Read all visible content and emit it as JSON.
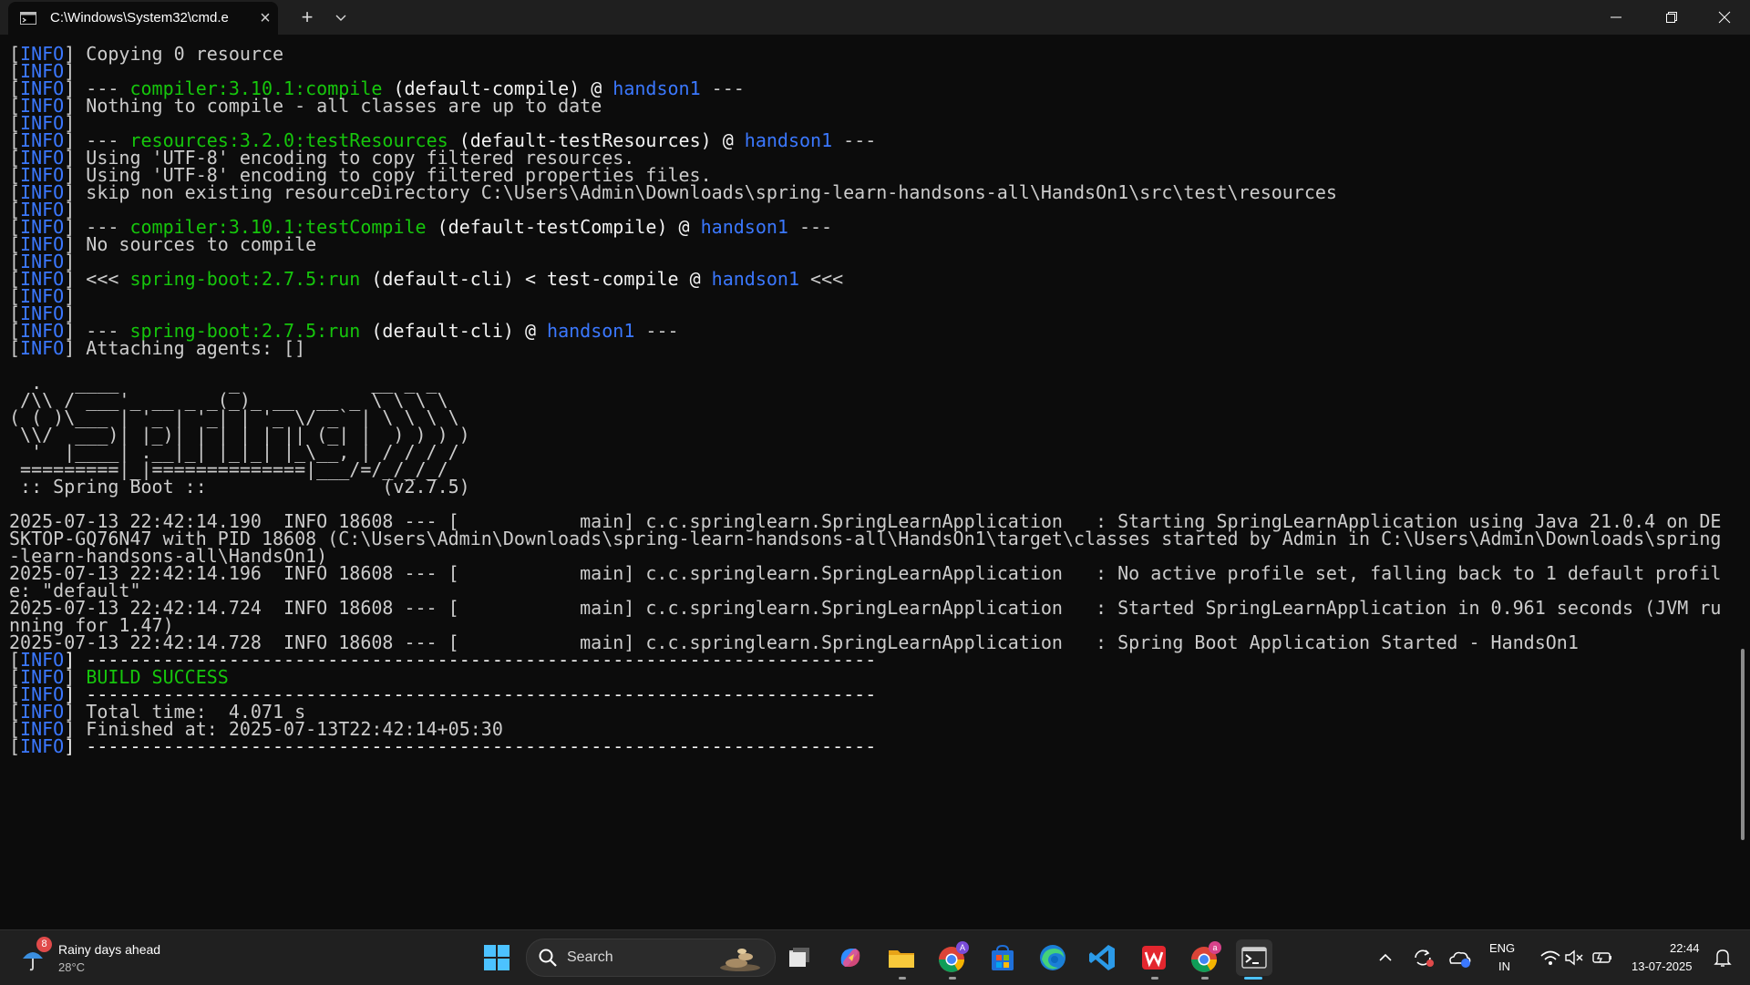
{
  "window": {
    "tab_title": "C:\\Windows\\System32\\cmd.e",
    "tab_close": "×",
    "new_tab": "+",
    "dropdown": "⌄"
  },
  "terminal": {
    "lines": [
      [
        {
          "t": "[",
          "c": ""
        },
        {
          "t": "INFO",
          "c": "lbl"
        },
        {
          "t": "] Copying 0 resource",
          "c": ""
        }
      ],
      [
        {
          "t": "[",
          "c": ""
        },
        {
          "t": "INFO",
          "c": "lbl"
        },
        {
          "t": "]",
          "c": ""
        }
      ],
      [
        {
          "t": "[",
          "c": ""
        },
        {
          "t": "INFO",
          "c": "lbl"
        },
        {
          "t": "] --- ",
          "c": ""
        },
        {
          "t": "compiler:3.10.1:compile",
          "c": "grn"
        },
        {
          "t": " (default-compile) @ ",
          "c": "bold"
        },
        {
          "t": "handson1",
          "c": "blu"
        },
        {
          "t": " ---",
          "c": ""
        }
      ],
      [
        {
          "t": "[",
          "c": ""
        },
        {
          "t": "INFO",
          "c": "lbl"
        },
        {
          "t": "] Nothing to compile - all classes are up to date",
          "c": ""
        }
      ],
      [
        {
          "t": "[",
          "c": ""
        },
        {
          "t": "INFO",
          "c": "lbl"
        },
        {
          "t": "]",
          "c": ""
        }
      ],
      [
        {
          "t": "[",
          "c": ""
        },
        {
          "t": "INFO",
          "c": "lbl"
        },
        {
          "t": "] --- ",
          "c": ""
        },
        {
          "t": "resources:3.2.0:testResources",
          "c": "grn"
        },
        {
          "t": " (default-testResources) @ ",
          "c": "bold"
        },
        {
          "t": "handson1",
          "c": "blu"
        },
        {
          "t": " ---",
          "c": ""
        }
      ],
      [
        {
          "t": "[",
          "c": ""
        },
        {
          "t": "INFO",
          "c": "lbl"
        },
        {
          "t": "] Using 'UTF-8' encoding to copy filtered resources.",
          "c": ""
        }
      ],
      [
        {
          "t": "[",
          "c": ""
        },
        {
          "t": "INFO",
          "c": "lbl"
        },
        {
          "t": "] Using 'UTF-8' encoding to copy filtered properties files.",
          "c": ""
        }
      ],
      [
        {
          "t": "[",
          "c": ""
        },
        {
          "t": "INFO",
          "c": "lbl"
        },
        {
          "t": "] skip non existing resourceDirectory C:\\Users\\Admin\\Downloads\\spring-learn-handsons-all\\HandsOn1\\src\\test\\resources",
          "c": ""
        }
      ],
      [
        {
          "t": "[",
          "c": ""
        },
        {
          "t": "INFO",
          "c": "lbl"
        },
        {
          "t": "]",
          "c": ""
        }
      ],
      [
        {
          "t": "[",
          "c": ""
        },
        {
          "t": "INFO",
          "c": "lbl"
        },
        {
          "t": "] --- ",
          "c": ""
        },
        {
          "t": "compiler:3.10.1:testCompile",
          "c": "grn"
        },
        {
          "t": " (default-testCompile) @ ",
          "c": "bold"
        },
        {
          "t": "handson1",
          "c": "blu"
        },
        {
          "t": " ---",
          "c": ""
        }
      ],
      [
        {
          "t": "[",
          "c": ""
        },
        {
          "t": "INFO",
          "c": "lbl"
        },
        {
          "t": "] No sources to compile",
          "c": ""
        }
      ],
      [
        {
          "t": "[",
          "c": ""
        },
        {
          "t": "INFO",
          "c": "lbl"
        },
        {
          "t": "]",
          "c": ""
        }
      ],
      [
        {
          "t": "[",
          "c": ""
        },
        {
          "t": "INFO",
          "c": "lbl"
        },
        {
          "t": "] <<< ",
          "c": ""
        },
        {
          "t": "spring-boot:2.7.5:run",
          "c": "grn"
        },
        {
          "t": " (default-cli) < test-compile @ ",
          "c": "bold"
        },
        {
          "t": "handson1",
          "c": "blu"
        },
        {
          "t": " <<<",
          "c": ""
        }
      ],
      [
        {
          "t": "[",
          "c": ""
        },
        {
          "t": "INFO",
          "c": "lbl"
        },
        {
          "t": "]",
          "c": ""
        }
      ],
      [
        {
          "t": "[",
          "c": ""
        },
        {
          "t": "INFO",
          "c": "lbl"
        },
        {
          "t": "]",
          "c": ""
        }
      ],
      [
        {
          "t": "[",
          "c": ""
        },
        {
          "t": "INFO",
          "c": "lbl"
        },
        {
          "t": "] --- ",
          "c": ""
        },
        {
          "t": "spring-boot:2.7.5:run",
          "c": "grn"
        },
        {
          "t": " (default-cli) @ ",
          "c": "bold"
        },
        {
          "t": "handson1",
          "c": "blu"
        },
        {
          "t": " ---",
          "c": ""
        }
      ],
      [
        {
          "t": "[",
          "c": ""
        },
        {
          "t": "INFO",
          "c": "lbl"
        },
        {
          "t": "] Attaching agents: []",
          "c": ""
        }
      ],
      [
        {
          "t": "",
          "c": ""
        }
      ],
      [
        {
          "t": "  .   ____          _            __ _ _",
          "c": ""
        }
      ],
      [
        {
          "t": " /\\\\ / ___'_ __ _ _(_)_ __  __ _ \\ \\ \\ \\",
          "c": ""
        }
      ],
      [
        {
          "t": "( ( )\\___ | '_ | '_| | '_ \\/ _` | \\ \\ \\ \\",
          "c": ""
        }
      ],
      [
        {
          "t": " \\\\/  ___)| |_)| | | | | || (_| |  ) ) ) )",
          "c": ""
        }
      ],
      [
        {
          "t": "  '  |____| .__|_| |_|_| |_\\__, | / / / /",
          "c": ""
        }
      ],
      [
        {
          "t": " =========|_|==============|___/=/_/_/_/",
          "c": ""
        }
      ],
      [
        {
          "t": " :: Spring Boot ::                (v2.7.5)",
          "c": ""
        }
      ],
      [
        {
          "t": "",
          "c": ""
        }
      ],
      [
        {
          "t": "2025-07-13 22:42:14.190  INFO 18608 --- [           main] c.c.springlearn.SpringLearnApplication   : Starting SpringLearnApplication using Java 21.0.4 on DE",
          "c": ""
        }
      ],
      [
        {
          "t": "SKTOP-GQ76N47 with PID 18608 (C:\\Users\\Admin\\Downloads\\spring-learn-handsons-all\\HandsOn1\\target\\classes started by Admin in C:\\Users\\Admin\\Downloads\\spring",
          "c": ""
        }
      ],
      [
        {
          "t": "-learn-handsons-all\\HandsOn1)",
          "c": ""
        }
      ],
      [
        {
          "t": "2025-07-13 22:42:14.196  INFO 18608 --- [           main] c.c.springlearn.SpringLearnApplication   : No active profile set, falling back to 1 default profil",
          "c": ""
        }
      ],
      [
        {
          "t": "e: \"default\"",
          "c": ""
        }
      ],
      [
        {
          "t": "2025-07-13 22:42:14.724  INFO 18608 --- [           main] c.c.springlearn.SpringLearnApplication   : Started SpringLearnApplication in 0.961 seconds (JVM ru",
          "c": ""
        }
      ],
      [
        {
          "t": "nning for 1.47)",
          "c": ""
        }
      ],
      [
        {
          "t": "2025-07-13 22:42:14.728  INFO 18608 --- [           main] c.c.springlearn.SpringLearnApplication   : Spring Boot Application Started - HandsOn1",
          "c": ""
        }
      ],
      [
        {
          "t": "[",
          "c": ""
        },
        {
          "t": "INFO",
          "c": "lbl"
        },
        {
          "t": "] ------------------------------------------------------------------------",
          "c": "bold"
        }
      ],
      [
        {
          "t": "[",
          "c": ""
        },
        {
          "t": "INFO",
          "c": "lbl"
        },
        {
          "t": "] ",
          "c": ""
        },
        {
          "t": "BUILD SUCCESS",
          "c": "grn"
        }
      ],
      [
        {
          "t": "[",
          "c": ""
        },
        {
          "t": "INFO",
          "c": "lbl"
        },
        {
          "t": "] ------------------------------------------------------------------------",
          "c": "bold"
        }
      ],
      [
        {
          "t": "[",
          "c": ""
        },
        {
          "t": "INFO",
          "c": "lbl"
        },
        {
          "t": "] Total time:  4.071 s",
          "c": ""
        }
      ],
      [
        {
          "t": "[",
          "c": ""
        },
        {
          "t": "INFO",
          "c": "lbl"
        },
        {
          "t": "] Finished at: 2025-07-13T22:42:14+05:30",
          "c": ""
        }
      ],
      [
        {
          "t": "[",
          "c": ""
        },
        {
          "t": "INFO",
          "c": "lbl"
        },
        {
          "t": "] ------------------------------------------------------------------------",
          "c": "bold"
        }
      ]
    ]
  },
  "taskbar": {
    "weather": {
      "badge": "8",
      "text": "Rainy days ahead",
      "temp": "28°C"
    },
    "search_label": "Search",
    "lang_top": "ENG",
    "lang_bottom": "IN",
    "time": "22:44",
    "date": "13-07-2025",
    "chrome_badges": [
      "A",
      "a"
    ]
  },
  "colors": {
    "terminal_bg": "#0c0c0c",
    "info_blue": "#3b78ff",
    "plugin_green": "#16c60c",
    "text": "#cccccc"
  }
}
